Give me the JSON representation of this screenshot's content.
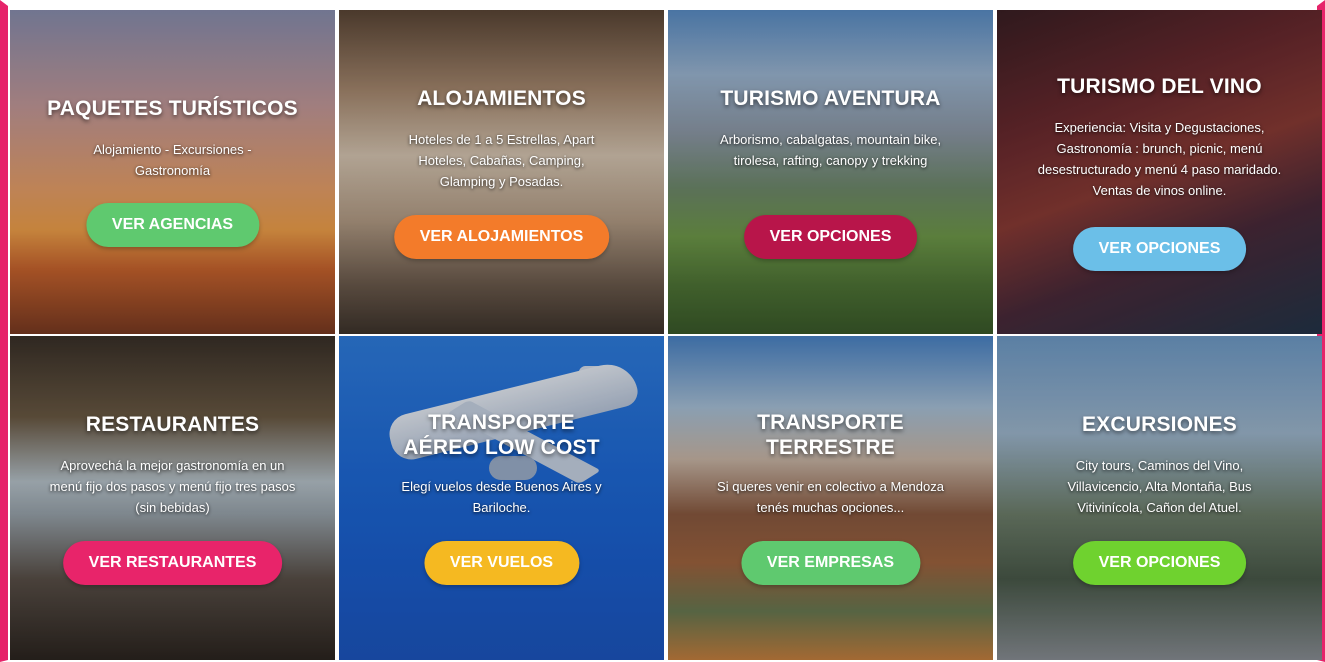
{
  "cards": [
    {
      "title": "PAQUETES TURÍSTICOS",
      "desc": "Alojamiento - Excursiones - Gastronomía",
      "button": "VER AGENCIAS",
      "button_color": "#5fc96f"
    },
    {
      "title": "ALOJAMIENTOS",
      "desc": "Hoteles de 1 a 5 Estrellas, Apart Hoteles, Cabañas, Camping, Glamping y Posadas.",
      "button": "VER ALOJAMIENTOS",
      "button_color": "#f37b2a"
    },
    {
      "title": "TURISMO AVENTURA",
      "desc": "Arborismo, cabalgatas, mountain bike, tirolesa, rafting, canopy y trekking",
      "button": "VER OPCIONES",
      "button_color": "#b8154a"
    },
    {
      "title": "TURISMO DEL VINO",
      "desc": "Experiencia: Visita y Degustaciones, Gastronomía : brunch, picnic, menú desestructurado y menú 4 paso maridado. Ventas de vinos online.",
      "button": "VER OPCIONES",
      "button_color": "#6bbfe8"
    },
    {
      "title": "RESTAURANTES",
      "desc": "Aprovechá la mejor gastronomía en un menú fijo dos pasos y menú fijo tres pasos (sin bebidas)",
      "button": "VER RESTAURANTES",
      "button_color": "#e8246a"
    },
    {
      "title": "TRANSPORTE AÉREO LOW COST",
      "desc": "Elegí vuelos desde Buenos Aires y Bariloche.",
      "button": "VER VUELOS",
      "button_color": "#f5b921"
    },
    {
      "title": "TRANSPORTE TERRESTRE",
      "desc": "Si queres venir en colectivo a Mendoza tenés muchas opciones...",
      "button": "VER EMPRESAS",
      "button_color": "#5fc96f"
    },
    {
      "title": "EXCURSIONES",
      "desc": "City tours, Caminos del Vino, Villavicencio, Alta Montaña, Bus Vitivinícola, Cañon del Atuel.",
      "button": "VER OPCIONES",
      "button_color": "#6fd22f"
    }
  ]
}
